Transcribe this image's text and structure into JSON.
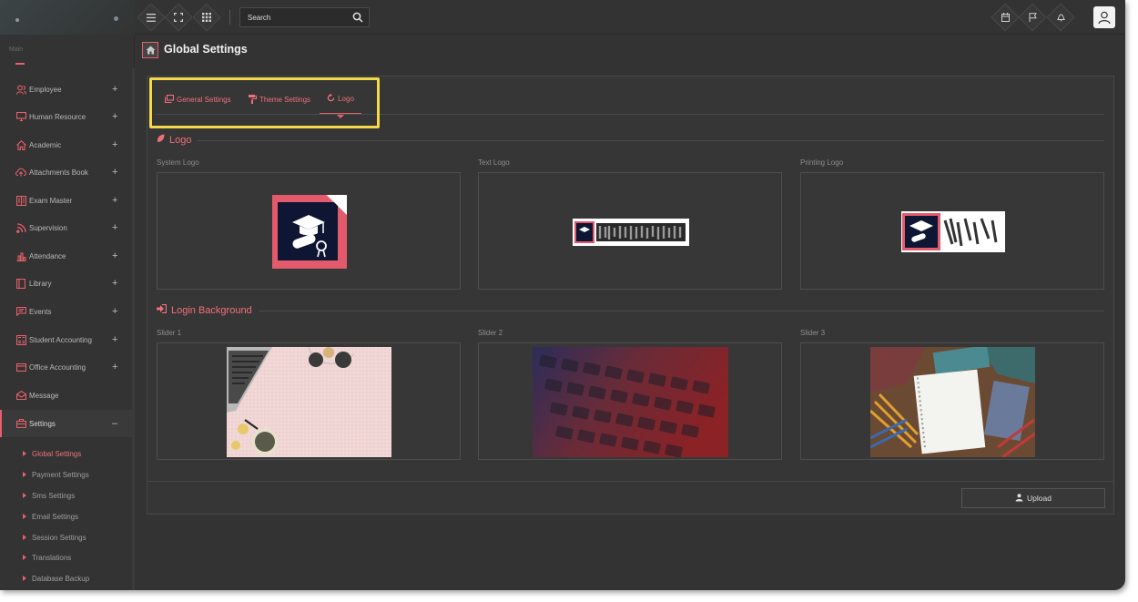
{
  "header": {
    "search_placeholder": "Search"
  },
  "sidebar": {
    "section_label": "Main",
    "items": [
      {
        "label": "Employee",
        "icon": "user-group-icon",
        "expand": "+"
      },
      {
        "label": "Human Resource",
        "icon": "monitor-icon",
        "expand": "+"
      },
      {
        "label": "Academic",
        "icon": "home-icon",
        "expand": "+"
      },
      {
        "label": "Attachments Book",
        "icon": "cloud-upload-icon",
        "expand": "+"
      },
      {
        "label": "Exam Master",
        "icon": "book-icon",
        "expand": "+"
      },
      {
        "label": "Supervision",
        "icon": "rss-icon",
        "expand": "+"
      },
      {
        "label": "Attendance",
        "icon": "bar-chart-icon",
        "expand": "+"
      },
      {
        "label": "Library",
        "icon": "library-book-icon",
        "expand": "+"
      },
      {
        "label": "Events",
        "icon": "message-square-icon",
        "expand": "+"
      },
      {
        "label": "Student Accounting",
        "icon": "calculator-icon",
        "expand": "+"
      },
      {
        "label": "Office Accounting",
        "icon": "credit-card-icon",
        "expand": "+"
      },
      {
        "label": "Message",
        "icon": "envelope-open-icon",
        "expand": ""
      },
      {
        "label": "Settings",
        "icon": "briefcase-icon",
        "expand": "–"
      }
    ],
    "settings_sub": [
      "Global Settings",
      "Payment Settings",
      "Sms Settings",
      "Email Settings",
      "Session Settings",
      "Translations",
      "Database Backup"
    ]
  },
  "page": {
    "title": "Global Settings"
  },
  "tabs": [
    {
      "label": "General Settings",
      "icon": "settings-window-icon"
    },
    {
      "label": "Theme Settings",
      "icon": "paint-roller-icon"
    },
    {
      "label": "Logo",
      "icon": "refresh-icon"
    }
  ],
  "logo_section": {
    "title": "Logo",
    "boxes": [
      "System Logo",
      "Text Logo",
      "Printing Logo"
    ]
  },
  "login_section": {
    "title": "Login Background",
    "boxes": [
      "Slider 1",
      "Slider 2",
      "Slider 3"
    ]
  },
  "upload_label": "Upload",
  "colors": {
    "accent": "#e4606a",
    "background": "#333333",
    "highlight": "#f5d94a"
  }
}
